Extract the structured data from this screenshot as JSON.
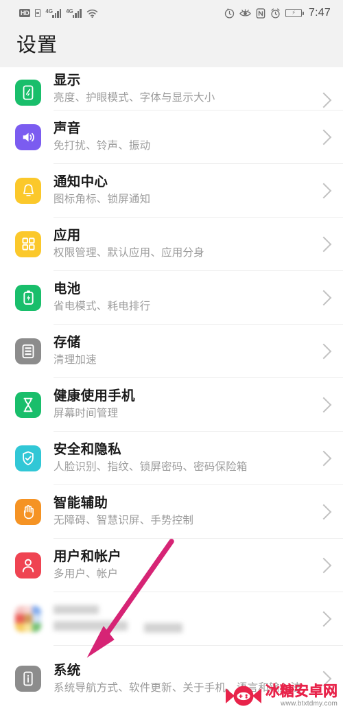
{
  "status_bar": {
    "hd_label": "HD",
    "network_gen_1": "4G",
    "network_gen_2": "4G",
    "time": "7:47",
    "icons": [
      "hd-badge",
      "sim-card-icon",
      "signal-bars-icon",
      "signal-bars-icon",
      "wifi-icon",
      "timer-icon",
      "eye-comfort-icon",
      "nfc-icon",
      "alarm-icon",
      "battery-icon"
    ]
  },
  "header": {
    "title": "设置"
  },
  "settings": {
    "items": [
      {
        "title": "显示",
        "subtitle": "亮度、护眼模式、字体与显示大小",
        "icon": "display-icon",
        "icon_color": "#19be6b"
      },
      {
        "title": "声音",
        "subtitle": "免打扰、铃声、振动",
        "icon": "sound-icon",
        "icon_color": "#7b5cf0"
      },
      {
        "title": "通知中心",
        "subtitle": "图标角标、锁屏通知",
        "icon": "bell-icon",
        "icon_color": "#fbc82b"
      },
      {
        "title": "应用",
        "subtitle": "权限管理、默认应用、应用分身",
        "icon": "apps-grid-icon",
        "icon_color": "#fbc82b"
      },
      {
        "title": "电池",
        "subtitle": "省电模式、耗电排行",
        "icon": "battery-charging-icon",
        "icon_color": "#19be6b"
      },
      {
        "title": "存储",
        "subtitle": "清理加速",
        "icon": "storage-icon",
        "icon_color": "#8c8c8c"
      },
      {
        "title": "健康使用手机",
        "subtitle": "屏幕时间管理",
        "icon": "hourglass-icon",
        "icon_color": "#19be6b"
      },
      {
        "title": "安全和隐私",
        "subtitle": "人脸识别、指纹、锁屏密码、密码保险箱",
        "icon": "shield-check-icon",
        "icon_color": "#31c7d6"
      },
      {
        "title": "智能辅助",
        "subtitle": "无障碍、智慧识屏、手势控制",
        "icon": "hand-icon",
        "icon_color": "#f59324"
      },
      {
        "title": "用户和帐户",
        "subtitle": "多用户、帐户",
        "icon": "user-account-icon",
        "icon_color": "#ef4452"
      },
      {
        "title": "",
        "subtitle": "",
        "icon": "redacted-mosaic-icon",
        "icon_color": "",
        "redacted": true
      },
      {
        "title": "系统",
        "subtitle": "系统导航方式、软件更新、关于手机、语言和输入法",
        "icon": "system-info-icon",
        "icon_color": "#8c8c8c"
      }
    ]
  },
  "annotation": {
    "type": "arrow",
    "color": "#d62475",
    "points_to": "系统"
  },
  "watermark": {
    "name": "冰糖安卓网",
    "url": "www.btxtdmy.com",
    "logo": "candy-gamepad-logo",
    "color": "#e8234a"
  }
}
